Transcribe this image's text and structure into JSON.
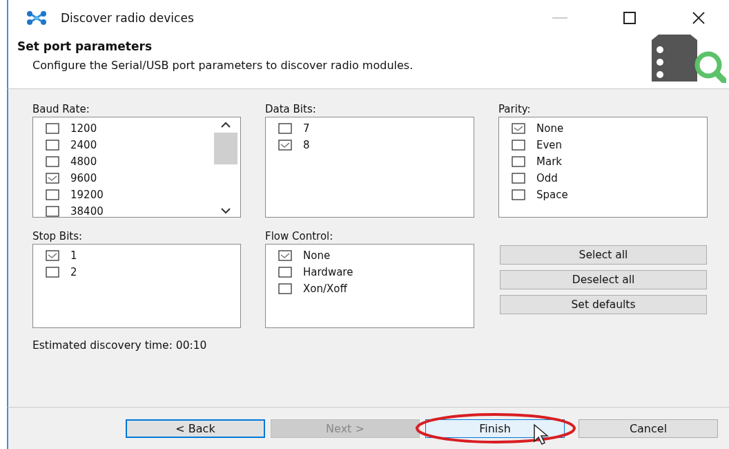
{
  "window": {
    "title": "Discover radio devices"
  },
  "header": {
    "title": "Set port parameters",
    "description": "Configure the Serial/USB port parameters to discover radio modules."
  },
  "groups": [
    {
      "label": "Baud Rate:",
      "scrollable": true,
      "options": [
        {
          "label": "1200",
          "checked": false
        },
        {
          "label": "2400",
          "checked": false
        },
        {
          "label": "4800",
          "checked": false
        },
        {
          "label": "9600",
          "checked": true
        },
        {
          "label": "19200",
          "checked": false
        },
        {
          "label": "38400",
          "checked": false
        }
      ]
    },
    {
      "label": "Data Bits:",
      "scrollable": false,
      "options": [
        {
          "label": "7",
          "checked": false
        },
        {
          "label": "8",
          "checked": true
        }
      ]
    },
    {
      "label": "Parity:",
      "scrollable": false,
      "options": [
        {
          "label": "None",
          "checked": true
        },
        {
          "label": "Even",
          "checked": false
        },
        {
          "label": "Mark",
          "checked": false
        },
        {
          "label": "Odd",
          "checked": false
        },
        {
          "label": "Space",
          "checked": false
        }
      ]
    },
    {
      "label": "Stop Bits:",
      "scrollable": false,
      "options": [
        {
          "label": "1",
          "checked": true
        },
        {
          "label": "2",
          "checked": false
        }
      ]
    },
    {
      "label": "Flow Control:",
      "scrollable": false,
      "options": [
        {
          "label": "None",
          "checked": true
        },
        {
          "label": "Hardware",
          "checked": false
        },
        {
          "label": "Xon/Xoff",
          "checked": false
        }
      ]
    }
  ],
  "side_buttons": [
    "Select all",
    "Deselect all",
    "Set defaults"
  ],
  "estimate": "Estimated discovery time: 00:10",
  "footer_buttons": [
    {
      "label": "< Back",
      "disabled": false,
      "focused": true,
      "circled": false
    },
    {
      "label": "Next >",
      "disabled": true,
      "focused": false,
      "circled": false
    },
    {
      "label": "Finish",
      "disabled": false,
      "focused": false,
      "circled": true
    },
    {
      "label": "Cancel",
      "disabled": false,
      "focused": false,
      "circled": false
    }
  ]
}
